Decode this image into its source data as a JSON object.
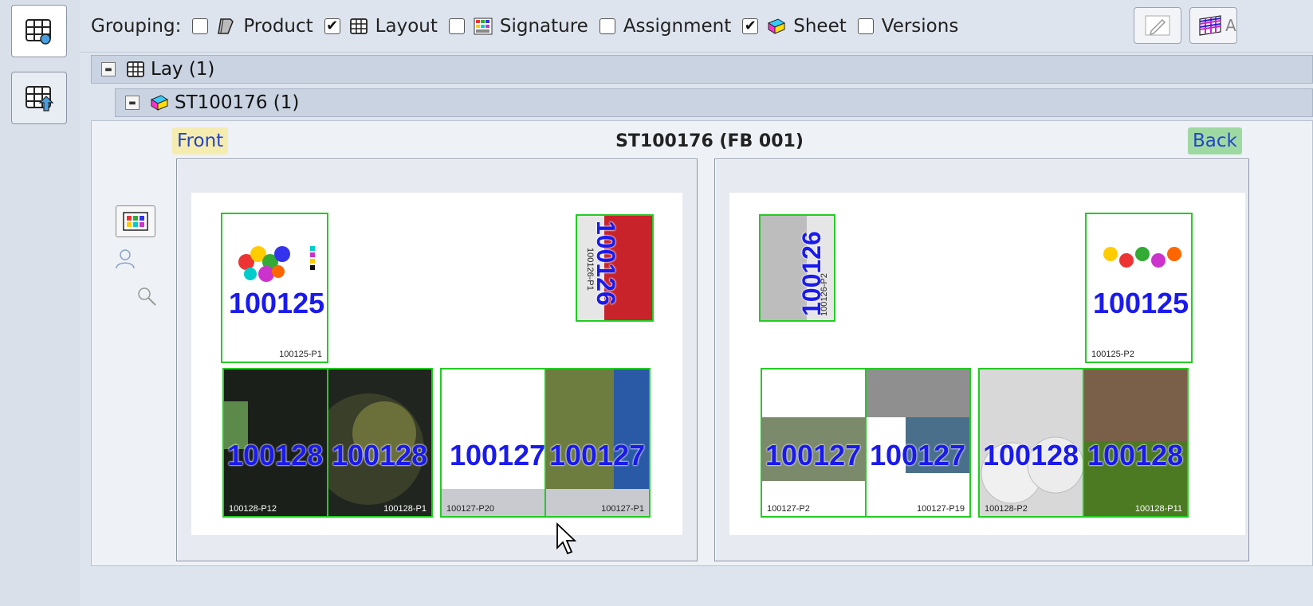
{
  "toolbar": {
    "grouping_label": "Grouping:",
    "items": [
      {
        "label": "Product",
        "checked": false,
        "icon": "product-icon"
      },
      {
        "label": "Layout",
        "checked": true,
        "icon": "layout-icon"
      },
      {
        "label": "Signature",
        "checked": false,
        "icon": "signature-icon"
      },
      {
        "label": "Assignment",
        "checked": false,
        "icon": ""
      },
      {
        "label": "Sheet",
        "checked": true,
        "icon": "sheet-icon"
      },
      {
        "label": "Versions",
        "checked": false,
        "icon": ""
      }
    ],
    "truncated_label": "A",
    "check_mark": "✔"
  },
  "tree": {
    "row1": "Lay (1)",
    "row2": "ST100176 (1)"
  },
  "sheet": {
    "title": "ST100176 (FB 001)",
    "front_label": "Front",
    "back_label": "Back"
  },
  "front_pages": {
    "p1": {
      "num": "100125",
      "label": "100125-P1"
    },
    "p2": {
      "num": "100126",
      "label": "100126-P1"
    },
    "p3a": {
      "num": "100128",
      "label": "100128-P12"
    },
    "p3b": {
      "num": "100128",
      "label": "100128-P1"
    },
    "p4a": {
      "num": "100127",
      "label": "100127-P20"
    },
    "p4b": {
      "num": "100127",
      "label": "100127-P1"
    }
  },
  "back_pages": {
    "p1": {
      "num": "100126",
      "label": "100126-P2"
    },
    "p2": {
      "num": "100125",
      "label": "100125-P2"
    },
    "p3a": {
      "num": "100127",
      "label": "100127-P2"
    },
    "p3b": {
      "num": "100127",
      "label": "100127-P19"
    },
    "p4a": {
      "num": "100128",
      "label": "100128-P2"
    },
    "p4b": {
      "num": "100128",
      "label": "100128-P11"
    }
  },
  "colors": {
    "page_border": "#22cc22",
    "page_number": "#1a1aee",
    "front_tag": "#f5ecb0",
    "back_tag": "#9fd9a2"
  }
}
